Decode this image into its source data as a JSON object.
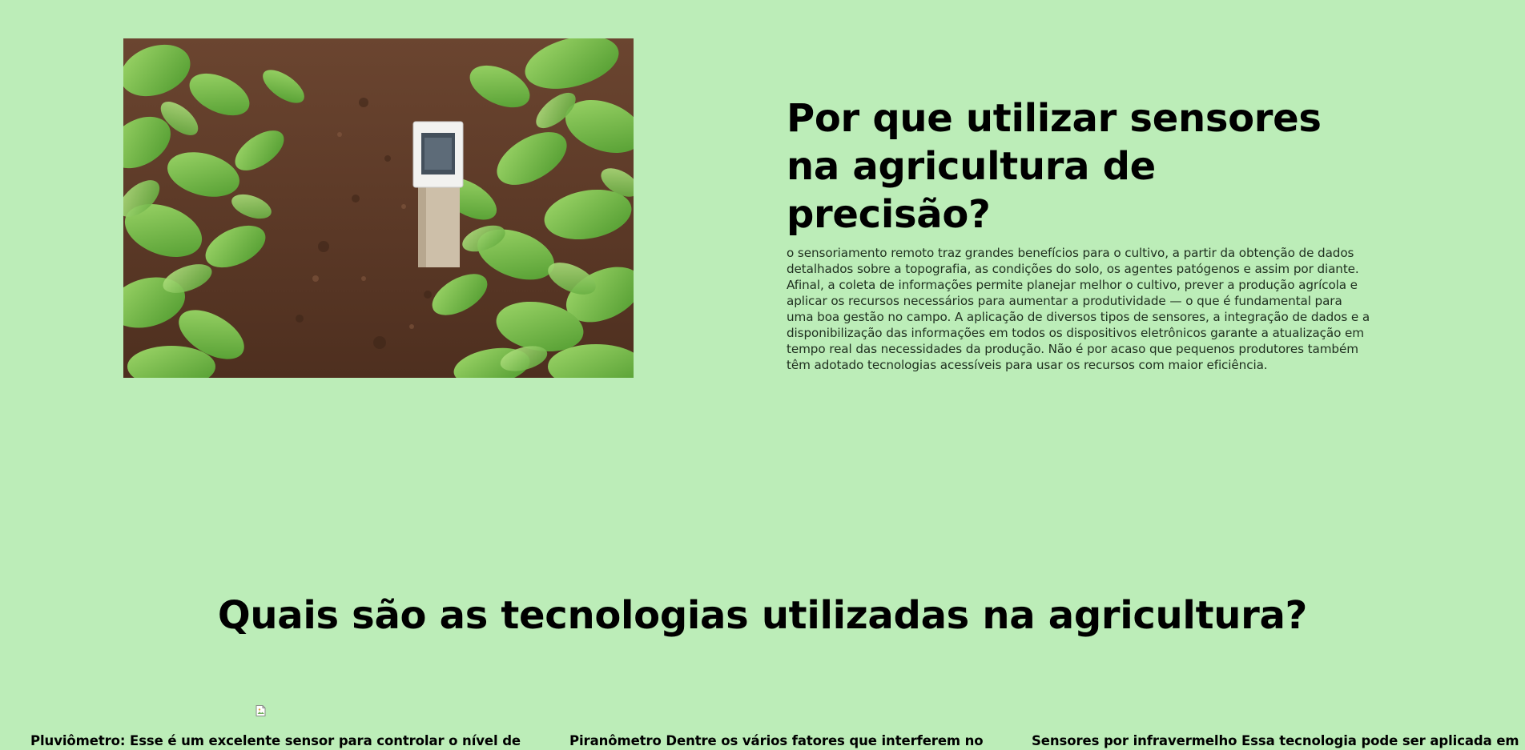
{
  "hero": {
    "photo_icon": "crop-field-with-soil-sensor",
    "title": "Por que utilizar sensores na agricultura de precisão?",
    "paragraph": "o sensoriamento remoto traz grandes benefícios para o cultivo, a partir da obtenção de dados detalhados sobre a topografia, as condições do solo, os agentes patógenos e assim por diante. Afinal, a coleta de informações permite planejar melhor o cultivo, prever a produção agrícola e aplicar os recursos necessários para aumentar a produtividade — o que é fundamental para uma boa gestão no campo. A aplicação de diversos tipos de sensores, a integração de dados e a disponibilização das informações em todos os dispositivos eletrônicos garante a atualização em tempo real das necessidades da produção. Não é por acaso que pequenos produtores também têm adotado tecnologias acessíveis para usar os recursos com maior eficiência."
  },
  "technologies": {
    "heading": "Quais são as tecnologias utilizadas na agricultura?",
    "broken_image_icon": "broken-image-icon",
    "cards": [
      {
        "text": "Pluviômetro: Esse é um excelente sensor para controlar o nível de"
      },
      {
        "text": "Piranômetro Dentre os vários fatores que interferem no"
      },
      {
        "text": "Sensores por infravermelho Essa tecnologia pode ser aplicada em"
      }
    ]
  },
  "colors": {
    "page_background": "#bcedb8",
    "heading_text": "#000000",
    "body_text": "#1f2f1f"
  }
}
